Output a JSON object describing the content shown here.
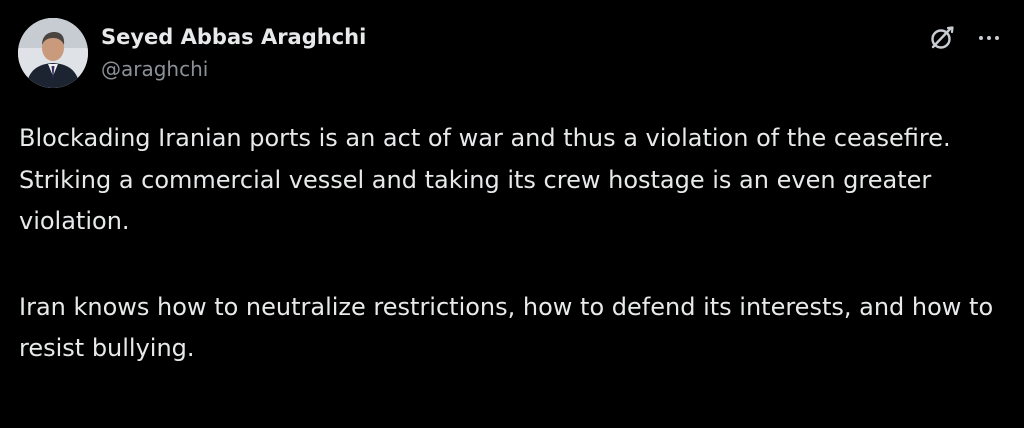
{
  "author": {
    "name": "Seyed Abbas Araghchi",
    "handle": "@araghchi",
    "avatar_icon": "profile-photo"
  },
  "actions": {
    "grok_icon": "grok-icon",
    "more_icon": "more-options-icon"
  },
  "post": {
    "paragraphs": [
      "Blockading Iranian ports is an act of war and thus a violation of the ceasefire.",
      "Striking a commercial vessel and taking its crew hostage is an even greater violation.",
      "Iran knows how to neutralize restrictions, how to defend its interests, and how to resist bullying."
    ]
  },
  "colors": {
    "background": "#000000",
    "text": "#e7e9ea",
    "secondary_text": "#8b9196"
  }
}
